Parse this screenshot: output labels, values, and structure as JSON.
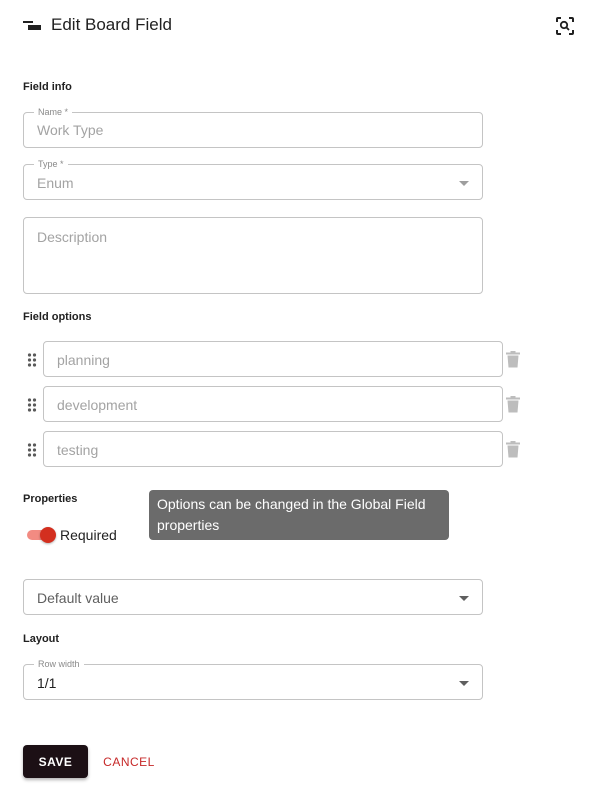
{
  "header": {
    "title": "Edit Board Field",
    "left_icon": "board-field-icon",
    "right_icon": "scan-search-icon"
  },
  "field_info": {
    "section_label": "Field info",
    "name": {
      "label": "Name *",
      "value": "Work Type"
    },
    "type": {
      "label": "Type *",
      "value": "Enum"
    },
    "description": {
      "placeholder": "Description"
    }
  },
  "field_options": {
    "section_label": "Field options",
    "items": [
      {
        "value": "planning"
      },
      {
        "value": "development"
      },
      {
        "value": "testing"
      }
    ]
  },
  "properties": {
    "section_label": "Properties",
    "required_label": "Required",
    "required_on": true
  },
  "tooltip": {
    "text": "Options can be changed in the Global Field properties"
  },
  "default_value": {
    "placeholder": "Default value"
  },
  "layout": {
    "section_label": "Layout",
    "row_width": {
      "label": "Row width",
      "value": "1/1"
    }
  },
  "actions": {
    "save_label": "SAVE",
    "cancel_label": "CANCEL"
  },
  "colors": {
    "save_button": "#1c1015",
    "cancel_text": "#c62828",
    "toggle_thumb": "#d32f1f",
    "toggle_track": "#f28b82",
    "tooltip_bg": "#6b6b6b"
  }
}
